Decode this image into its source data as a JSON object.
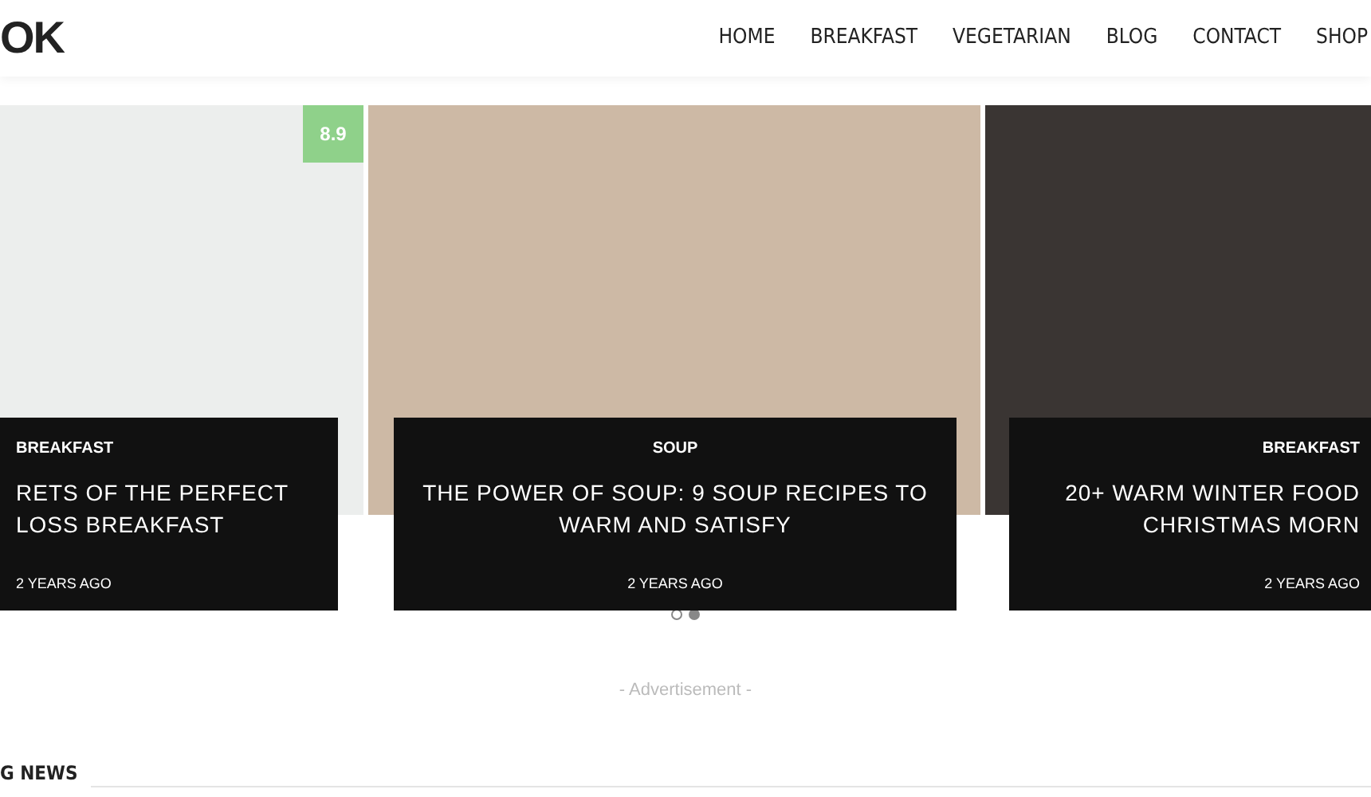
{
  "logo": "OK",
  "nav": [
    {
      "label": "HOME"
    },
    {
      "label": "BREAKFAST"
    },
    {
      "label": "VEGETARIAN"
    },
    {
      "label": "BLOG"
    },
    {
      "label": "CONTACT"
    },
    {
      "label": "SHOP"
    }
  ],
  "slides": [
    {
      "category": "BREAKFAST",
      "title": "RETS OF THE PERFECT LOSS BREAKFAST",
      "time": "2 YEARS AGO",
      "rating": "8.9"
    },
    {
      "category": "SOUP",
      "title": "THE POWER OF SOUP: 9 SOUP RECIPES TO WARM AND SATISFY",
      "time": "2 YEARS AGO"
    },
    {
      "category": "BREAKFAST",
      "title": "20+ WARM WINTER FOOD CHRISTMAS MORN",
      "time": "2 YEARS AGO"
    }
  ],
  "dots": [
    {
      "selected": false
    },
    {
      "selected": true
    }
  ],
  "advertisement": "- Advertisement -",
  "section_heading": "G NEWS"
}
